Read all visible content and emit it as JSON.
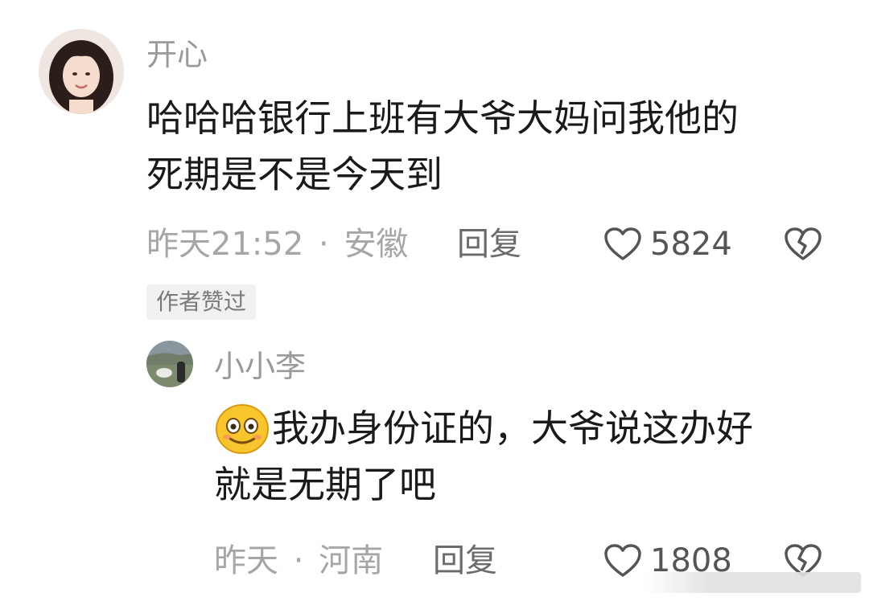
{
  "comments": [
    {
      "username": "开心",
      "text_lines": [
        "哈哈哈银行上班有大爷大妈问我他的",
        "死期是不是今天到"
      ],
      "time": "昨天21:52",
      "separator": "·",
      "location": "安徽",
      "reply_label": "回复",
      "like_count": "5824",
      "badge": "作者赞过"
    },
    {
      "username": "小小李",
      "text_lines": [
        "我办身份证的，大爷说这办好",
        "就是无期了吧"
      ],
      "time": "昨天",
      "separator": "·",
      "location": "河南",
      "reply_label": "回复",
      "like_count": "1808"
    }
  ],
  "icons": {
    "like": "heart-outline-icon",
    "dislike": "broken-heart-icon",
    "emoji": "smile-emoji-icon"
  }
}
